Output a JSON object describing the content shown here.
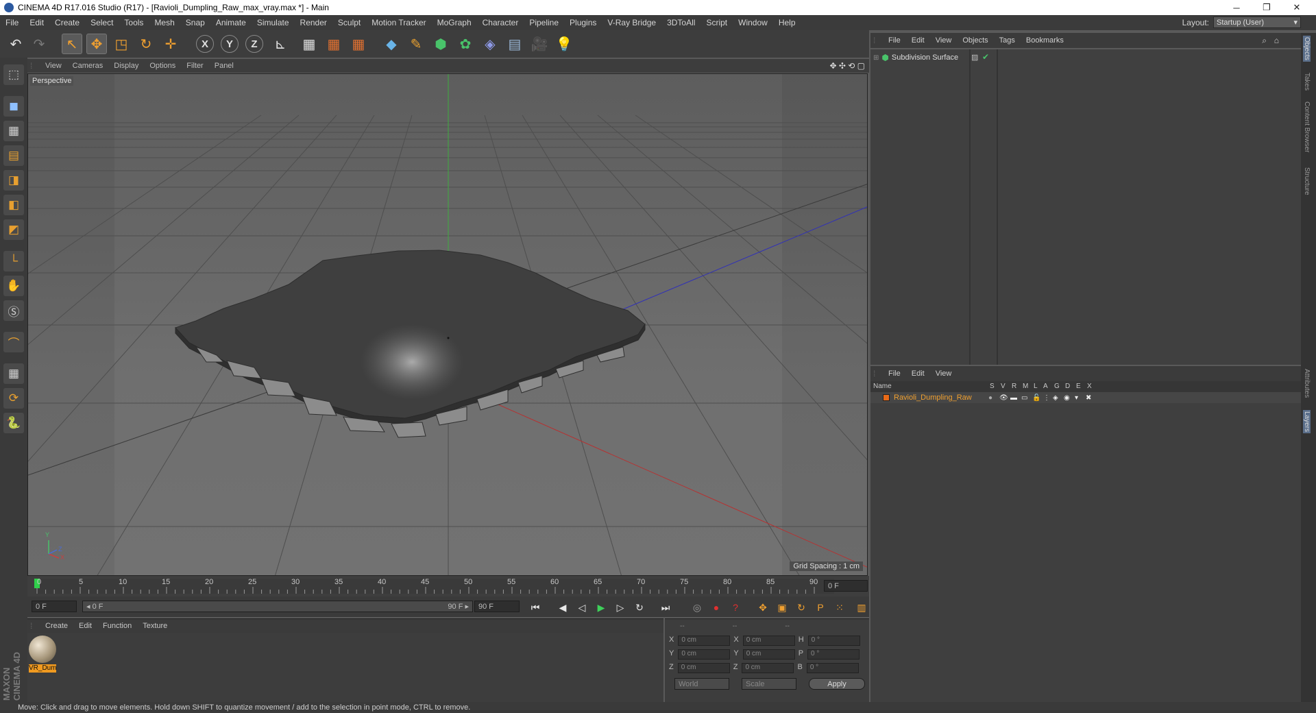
{
  "window": {
    "title": "CINEMA 4D R17.016 Studio (R17) - [Ravioli_Dumpling_Raw_max_vray.max *] - Main",
    "minimize": "─",
    "restore": "❐",
    "close": "✕"
  },
  "menu": [
    "File",
    "Edit",
    "Create",
    "Select",
    "Tools",
    "Mesh",
    "Snap",
    "Animate",
    "Simulate",
    "Render",
    "Sculpt",
    "Motion Tracker",
    "MoGraph",
    "Character",
    "Pipeline",
    "Plugins",
    "V-Ray Bridge",
    "3DToAll",
    "Script",
    "Window",
    "Help"
  ],
  "layout": {
    "label": "Layout:",
    "value": "Startup (User)"
  },
  "toolbar": {
    "undo": "↶",
    "redo": "↷",
    "live_select": "↖",
    "move": "✥",
    "scale": "◳",
    "rotate": "↻",
    "last_tool": "✛",
    "x": "X",
    "y": "Y",
    "z": "Z",
    "coord": "⊾",
    "render_view": "▦",
    "render_picture": "▦",
    "edit_render": "▦",
    "cube": "◆",
    "pen": "✎",
    "subdivision": "⬢",
    "mograph": "✿",
    "deformer": "◈",
    "floor": "▤",
    "camera": "🎥",
    "light": "💡"
  },
  "left_tools": [
    "⬚",
    "◼",
    "▦",
    "▤",
    "◨",
    "◧",
    "◩",
    "└",
    "✋",
    "Ⓢ",
    "⌒",
    "▦",
    "⟳",
    "🐍"
  ],
  "viewport": {
    "menu": [
      "View",
      "Cameras",
      "Display",
      "Options",
      "Filter",
      "Panel"
    ],
    "label": "Perspective",
    "grid_spacing": "Grid Spacing : 1 cm",
    "nav_icons": "✥ ✣ ⟲ ▢",
    "axis_x": "X",
    "axis_y": "Y",
    "axis_z": "Z"
  },
  "timeline": {
    "ticks": [
      "0",
      "5",
      "10",
      "15",
      "20",
      "25",
      "30",
      "35",
      "40",
      "45",
      "50",
      "55",
      "60",
      "65",
      "70",
      "75",
      "80",
      "85",
      "90"
    ],
    "current_frame_display": "0 F",
    "start": "0 F",
    "range_start": "◂ 0 F",
    "range_end": "90 F ▸",
    "end": "90 F"
  },
  "playback": {
    "first": "⏮",
    "prev_key": "◀",
    "prev": "◁",
    "play": "▶",
    "next": "▷",
    "next_key": "↻",
    "last": "⏭",
    "record_keys": "◎",
    "autokey": "●",
    "keyframe_sel": "?",
    "move": "✥",
    "scale": "▣",
    "rotate": "↻",
    "param": "P",
    "pla": "⁙",
    "timeline_btn": "▥"
  },
  "materials": {
    "menu": [
      "Create",
      "Edit",
      "Function",
      "Texture"
    ],
    "items": [
      {
        "name": "VR_Dum"
      }
    ]
  },
  "coordinates": {
    "header": [
      "--",
      "--",
      "--"
    ],
    "rows": [
      {
        "a": "X",
        "av": "0 cm",
        "b": "X",
        "bv": "0 cm",
        "c": "H",
        "cv": "0 °"
      },
      {
        "a": "Y",
        "av": "0 cm",
        "b": "Y",
        "bv": "0 cm",
        "c": "P",
        "cv": "0 °"
      },
      {
        "a": "Z",
        "av": "0 cm",
        "b": "Z",
        "bv": "0 cm",
        "c": "B",
        "cv": "0 °"
      }
    ],
    "world": "World",
    "scale": "Scale",
    "apply": "Apply"
  },
  "objects": {
    "menu": [
      "File",
      "Edit",
      "View",
      "Objects",
      "Tags",
      "Bookmarks"
    ],
    "items": [
      {
        "name": "Subdivision Surface"
      }
    ]
  },
  "layers": {
    "menu": [
      "File",
      "Edit",
      "View"
    ],
    "header": {
      "name": "Name",
      "cols": [
        "S",
        "V",
        "R",
        "M",
        "L",
        "A",
        "G",
        "D",
        "E",
        "X"
      ]
    },
    "items": [
      {
        "name": "Ravioli_Dumpling_Raw",
        "color": "#e86a18"
      }
    ]
  },
  "right_tabs": [
    "Objects",
    "Takes",
    "Content Browser",
    "Structure",
    "Attributes",
    "Layers"
  ],
  "brand": "MAXON CINEMA 4D",
  "status": "Move: Click and drag to move elements. Hold down SHIFT to quantize movement / add to the selection in point mode, CTRL to remove.",
  "colors": {
    "accent": "#e86a18",
    "selected_tab": "#5a6e8a"
  }
}
